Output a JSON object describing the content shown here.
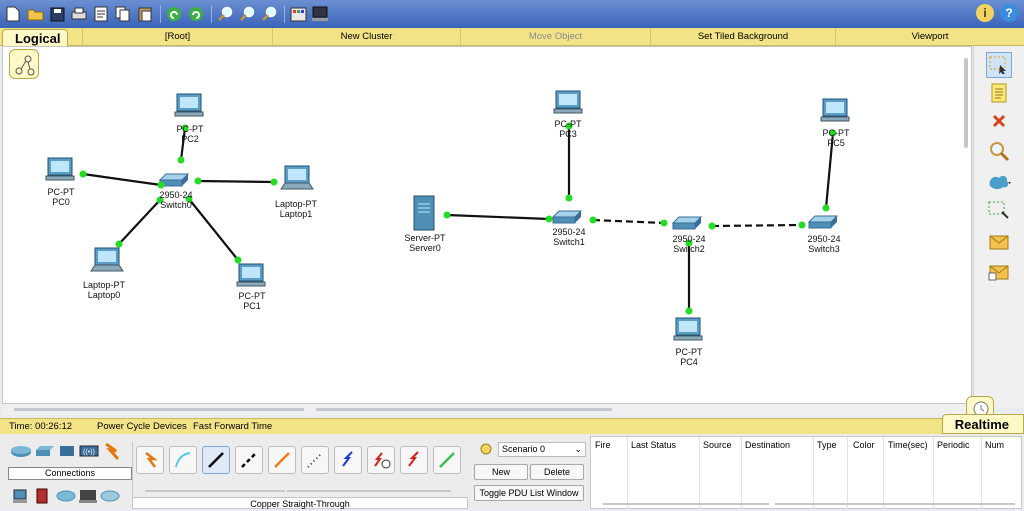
{
  "toolbar": {
    "icons": [
      "new-icon",
      "open-icon",
      "save-icon",
      "print-icon",
      "activity-wizard-icon",
      "copy-icon",
      "paste-icon",
      "undo-icon",
      "redo-icon",
      "zoom-in-icon",
      "zoom-reset-icon",
      "zoom-out-icon",
      "palette-icon",
      "custom-device-icon"
    ],
    "right_icons": [
      "info-icon",
      "help-icon"
    ],
    "info_glyph": "i",
    "help_glyph": "?"
  },
  "tabbar": {
    "logical_label": "Logical",
    "items": [
      "[Root]",
      "New Cluster",
      "Move Object",
      "Set Tiled Background",
      "Viewport"
    ],
    "disabled": [
      "Move Object"
    ]
  },
  "devices": [
    {
      "type": "PC-PT",
      "name": "PC0"
    },
    {
      "type": "PC-PT",
      "name": "PC2"
    },
    {
      "type": "2950-24",
      "name": "Switch0"
    },
    {
      "type": "Laptop-PT",
      "name": "Laptop1"
    },
    {
      "type": "Laptop-PT",
      "name": "Laptop0"
    },
    {
      "type": "PC-PT",
      "name": "PC1"
    },
    {
      "type": "PC-PT",
      "name": "PC3"
    },
    {
      "type": "Server-PT",
      "name": "Server0"
    },
    {
      "type": "2950-24",
      "name": "Switch1"
    },
    {
      "type": "2950-24",
      "name": "Switch2"
    },
    {
      "type": "2950-24",
      "name": "Switch3"
    },
    {
      "type": "PC-PT",
      "name": "PC5"
    },
    {
      "type": "PC-PT",
      "name": "PC4"
    }
  ],
  "links": [
    {
      "from": "PC0",
      "to": "Switch0",
      "style": "straight"
    },
    {
      "from": "PC2",
      "to": "Switch0",
      "style": "straight"
    },
    {
      "from": "Laptop1",
      "to": "Switch0",
      "style": "straight"
    },
    {
      "from": "Laptop0",
      "to": "Switch0",
      "style": "straight"
    },
    {
      "from": "PC1",
      "to": "Switch0",
      "style": "straight"
    },
    {
      "from": "PC3",
      "to": "Switch1",
      "style": "straight"
    },
    {
      "from": "Server0",
      "to": "Switch1",
      "style": "straight"
    },
    {
      "from": "Switch1",
      "to": "Switch2",
      "style": "cross"
    },
    {
      "from": "Switch2",
      "to": "Switch3",
      "style": "cross"
    },
    {
      "from": "PC5",
      "to": "Switch3",
      "style": "straight"
    },
    {
      "from": "PC4",
      "to": "Switch2",
      "style": "straight"
    }
  ],
  "palette": [
    "select-icon",
    "note-icon",
    "delete-icon",
    "inspect-icon",
    "draw-shape-icon",
    "resize-icon",
    "add-simple-pdu-icon",
    "add-complex-pdu-icon"
  ],
  "colors": {
    "link_up": "#22dd22",
    "toolbar": "#3a64b8",
    "tab": "#f3e387",
    "delete": "#d9431e"
  },
  "status": {
    "time_label": "Time: 00:26:12",
    "power_cycle": "Power Cycle Devices",
    "fast_forward": "Fast Forward Time",
    "realtime_label": "Realtime"
  },
  "device_categories": {
    "label": "Connections",
    "top_icons": [
      "routers-icon",
      "switches-icon",
      "hubs-icon",
      "wireless-icon",
      "connections-icon"
    ],
    "bottom_icons": [
      "end-devices-icon",
      "wan-emulation-icon",
      "custom-devices-icon",
      "multiuser-icon",
      "security-icon"
    ]
  },
  "connection_types": {
    "icons": [
      "automatic-icon",
      "console-icon",
      "copper-straight-icon",
      "copper-cross-icon",
      "fiber-icon",
      "phone-icon",
      "coaxial-icon",
      "serial-dce-icon",
      "serial-dte-icon",
      "octal-icon"
    ],
    "selected_name": "Copper Straight-Through"
  },
  "scenario": {
    "selected": "Scenario 0",
    "new_label": "New",
    "delete_label": "Delete",
    "toggle_label": "Toggle PDU List Window"
  },
  "pdu_columns": [
    "Fire",
    "Last Status",
    "Source",
    "Destination",
    "Type",
    "Color",
    "Time(sec)",
    "Periodic",
    "Num"
  ]
}
